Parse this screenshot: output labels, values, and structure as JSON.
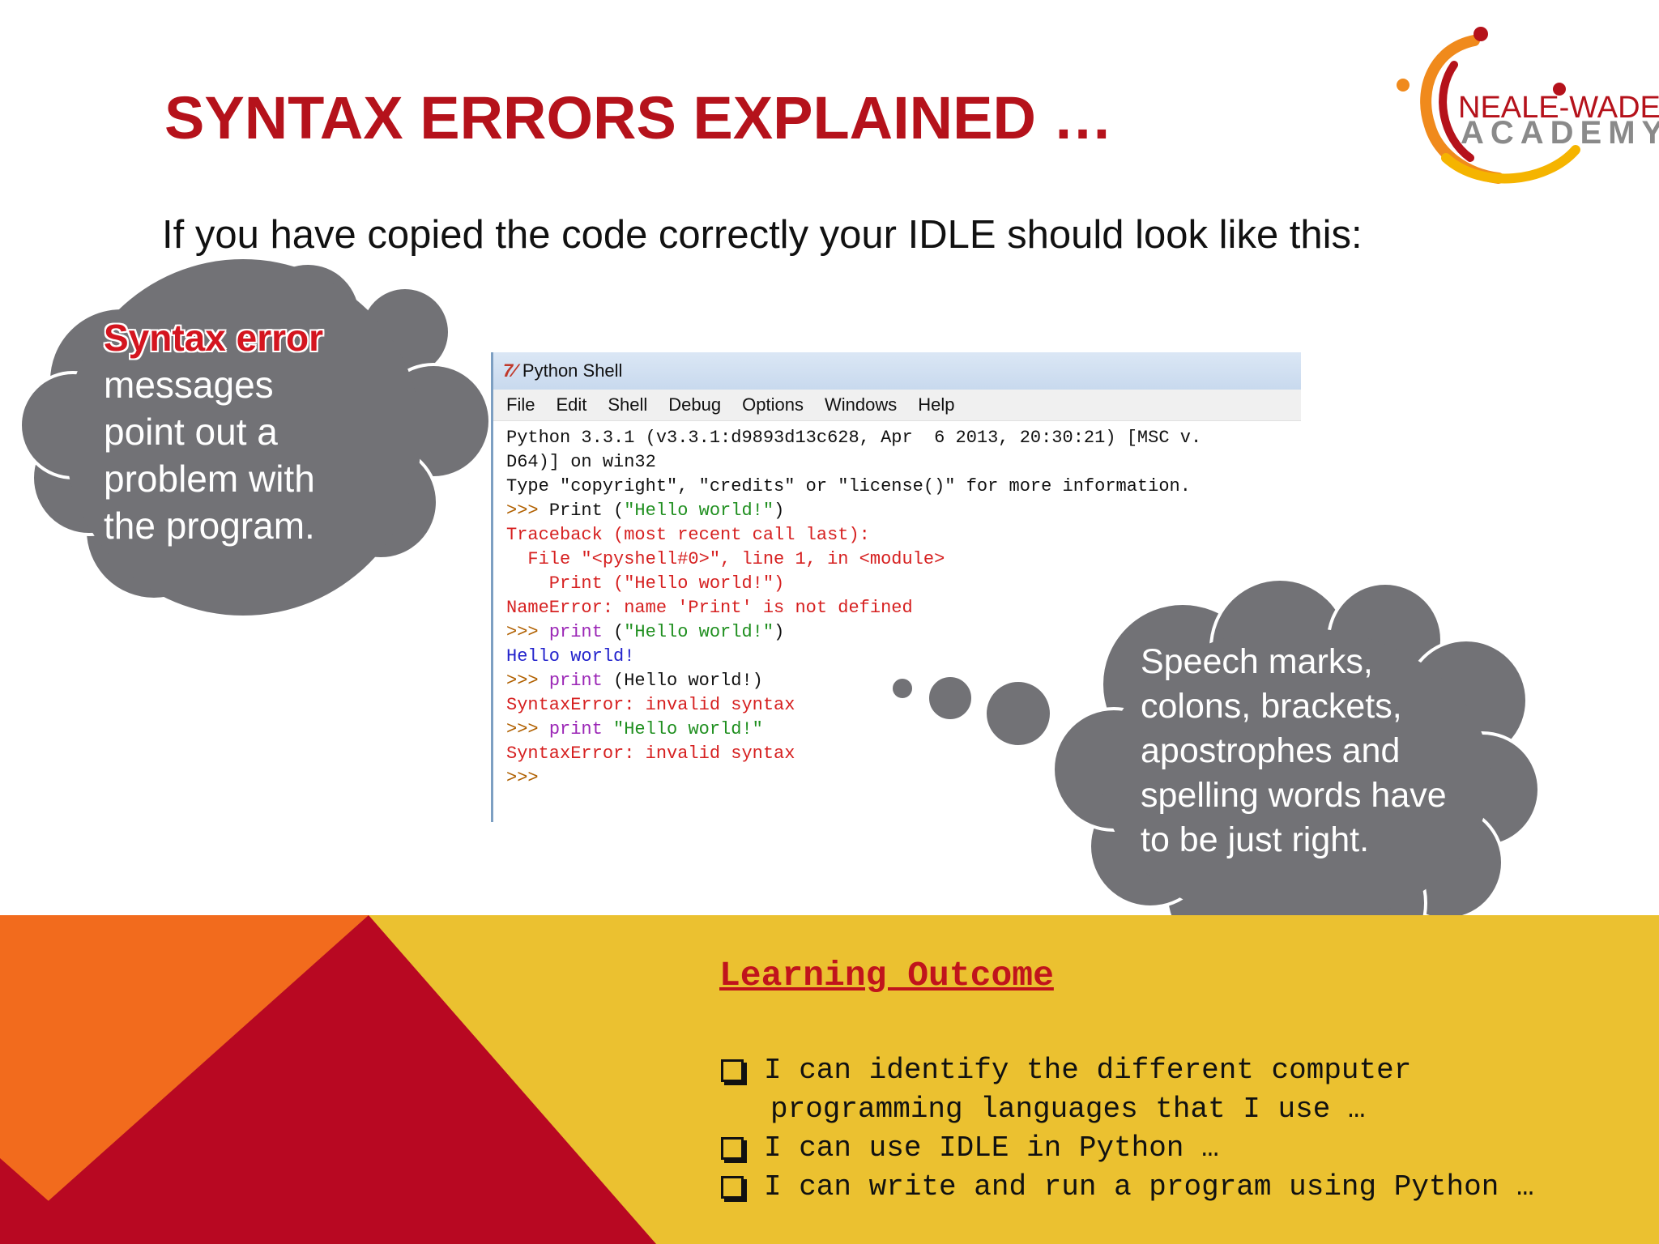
{
  "slide": {
    "title": "SYNTAX ERRORS EXPLAINED …",
    "subtitle": "If you have copied the code correctly your IDLE should look like this:"
  },
  "logo": {
    "name_top": "NEALE-WADE",
    "name_bottom": "ACADEMY",
    "colors": {
      "red": "#b5121b",
      "orange": "#f08a1c",
      "yellow": "#f5b400",
      "grey": "#8a8a8a"
    }
  },
  "idle": {
    "window_title": "Python Shell",
    "menu": [
      "File",
      "Edit",
      "Shell",
      "Debug",
      "Options",
      "Windows",
      "Help"
    ],
    "lines": [
      {
        "segments": [
          {
            "text": "Python 3.3.1 (v3.3.1:d9893d13c628, Apr  6 2013, 20:30:21) [MSC v.",
            "color": "black"
          }
        ]
      },
      {
        "segments": [
          {
            "text": "D64)] on win32",
            "color": "black"
          }
        ]
      },
      {
        "segments": [
          {
            "text": "Type \"copyright\", \"credits\" or \"license()\" for more information.",
            "color": "black"
          }
        ]
      },
      {
        "segments": [
          {
            "text": ">>> ",
            "color": "brown"
          },
          {
            "text": "Print (",
            "color": "black"
          },
          {
            "text": "\"Hello world!\"",
            "color": "green"
          },
          {
            "text": ")",
            "color": "black"
          }
        ]
      },
      {
        "segments": [
          {
            "text": "Traceback (most recent call last):",
            "color": "red"
          }
        ]
      },
      {
        "segments": [
          {
            "text": "  File \"<pyshell#0>\", line 1, in <module>",
            "color": "red"
          }
        ]
      },
      {
        "segments": [
          {
            "text": "    Print (\"Hello world!\")",
            "color": "red"
          }
        ]
      },
      {
        "segments": [
          {
            "text": "NameError: name 'Print' is not defined",
            "color": "red"
          }
        ]
      },
      {
        "segments": [
          {
            "text": ">>> ",
            "color": "brown"
          },
          {
            "text": "print",
            "color": "purple"
          },
          {
            "text": " (",
            "color": "black"
          },
          {
            "text": "\"Hello world!\"",
            "color": "green"
          },
          {
            "text": ")",
            "color": "black"
          }
        ]
      },
      {
        "segments": [
          {
            "text": "Hello world!",
            "color": "blue"
          }
        ]
      },
      {
        "segments": [
          {
            "text": ">>> ",
            "color": "brown"
          },
          {
            "text": "print",
            "color": "purple"
          },
          {
            "text": " (Hello world!)",
            "color": "black"
          }
        ]
      },
      {
        "segments": [
          {
            "text": "SyntaxError: invalid syntax",
            "color": "red"
          }
        ]
      },
      {
        "segments": [
          {
            "text": ">>> ",
            "color": "brown"
          },
          {
            "text": "print",
            "color": "purple"
          },
          {
            "text": " ",
            "color": "black"
          },
          {
            "text": "\"Hello world!\"",
            "color": "green"
          }
        ]
      },
      {
        "segments": [
          {
            "text": "SyntaxError: invalid syntax",
            "color": "red"
          }
        ]
      },
      {
        "segments": [
          {
            "text": ">>>",
            "color": "brown"
          }
        ]
      }
    ]
  },
  "cloud_left": {
    "highlight": "Syntax error",
    "text": "messages point out a problem with the program."
  },
  "cloud_right": {
    "text": "Speech marks, colons, brackets, apostrophes and spelling words have to be just right."
  },
  "learning_outcome": {
    "title": "Learning Outcome",
    "items": [
      {
        "line1": "I can identify the different computer",
        "line2": "programming languages that I use …"
      },
      {
        "line1": "I can use IDLE in Python …",
        "line2": ""
      },
      {
        "line1": "I can write and run a program using Python …",
        "line2": ""
      }
    ]
  },
  "colors": {
    "title_red": "#b5121b",
    "band_yellow": "#ebc130",
    "band_orange": "#f26b1d",
    "band_red": "#b80822",
    "cloud_grey": "#727276"
  }
}
